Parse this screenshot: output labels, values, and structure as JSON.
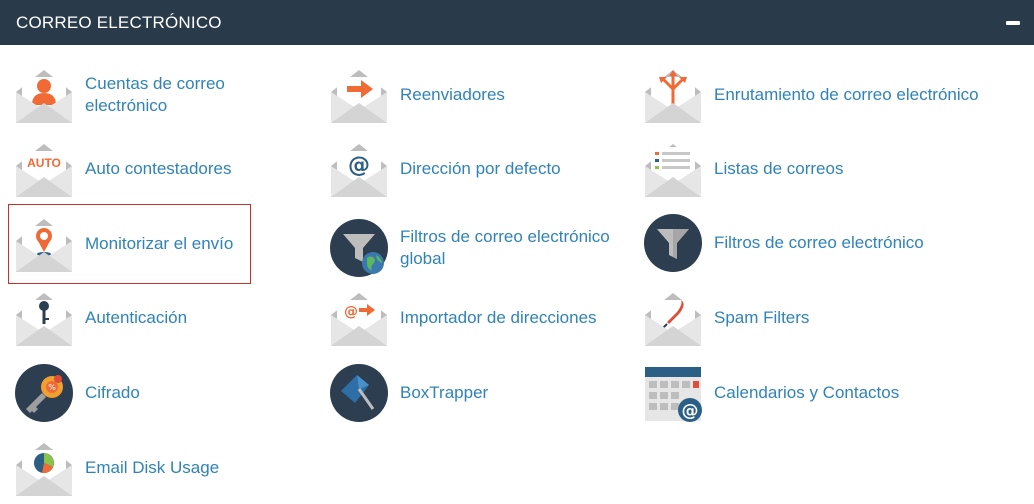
{
  "header": {
    "title": "CORREO ELECTRÓNICO",
    "collapse_icon": "minus-icon"
  },
  "colors": {
    "header_bg": "#293a4a",
    "link": "#2f83b8",
    "accent_orange": "#f06a35",
    "selection_border": "#c9302c"
  },
  "items": [
    {
      "label": "Cuentas de correo electrónico",
      "icon": "email-accounts-icon"
    },
    {
      "label": "Reenviadores",
      "icon": "forwarders-icon"
    },
    {
      "label": "Enrutamiento de correo electrónico",
      "icon": "email-routing-icon"
    },
    {
      "label": "Auto contestadores",
      "icon": "autoresponders-icon",
      "icon_text": "AUTO"
    },
    {
      "label": "Dirección por defecto",
      "icon": "default-address-icon",
      "icon_text": "@"
    },
    {
      "label": "Listas de correos",
      "icon": "mailing-lists-icon"
    },
    {
      "label": "Monitorizar el envío",
      "icon": "track-delivery-icon",
      "selected": true
    },
    {
      "label": "Filtros de correo electrónico global",
      "icon": "global-email-filters-icon"
    },
    {
      "label": "Filtros de correo electrónico",
      "icon": "email-filters-icon"
    },
    {
      "label": "Autenticación",
      "icon": "authentication-icon"
    },
    {
      "label": "Importador de direcciones",
      "icon": "address-importer-icon",
      "icon_text": "@"
    },
    {
      "label": "Spam Filters",
      "icon": "spam-filters-icon"
    },
    {
      "label": "Cifrado",
      "icon": "encryption-icon"
    },
    {
      "label": "BoxTrapper",
      "icon": "boxtrapper-icon"
    },
    {
      "label": "Calendarios y Contactos",
      "icon": "calendars-contacts-icon",
      "icon_text": "@"
    },
    {
      "label": "Email Disk Usage",
      "icon": "email-disk-usage-icon"
    }
  ]
}
